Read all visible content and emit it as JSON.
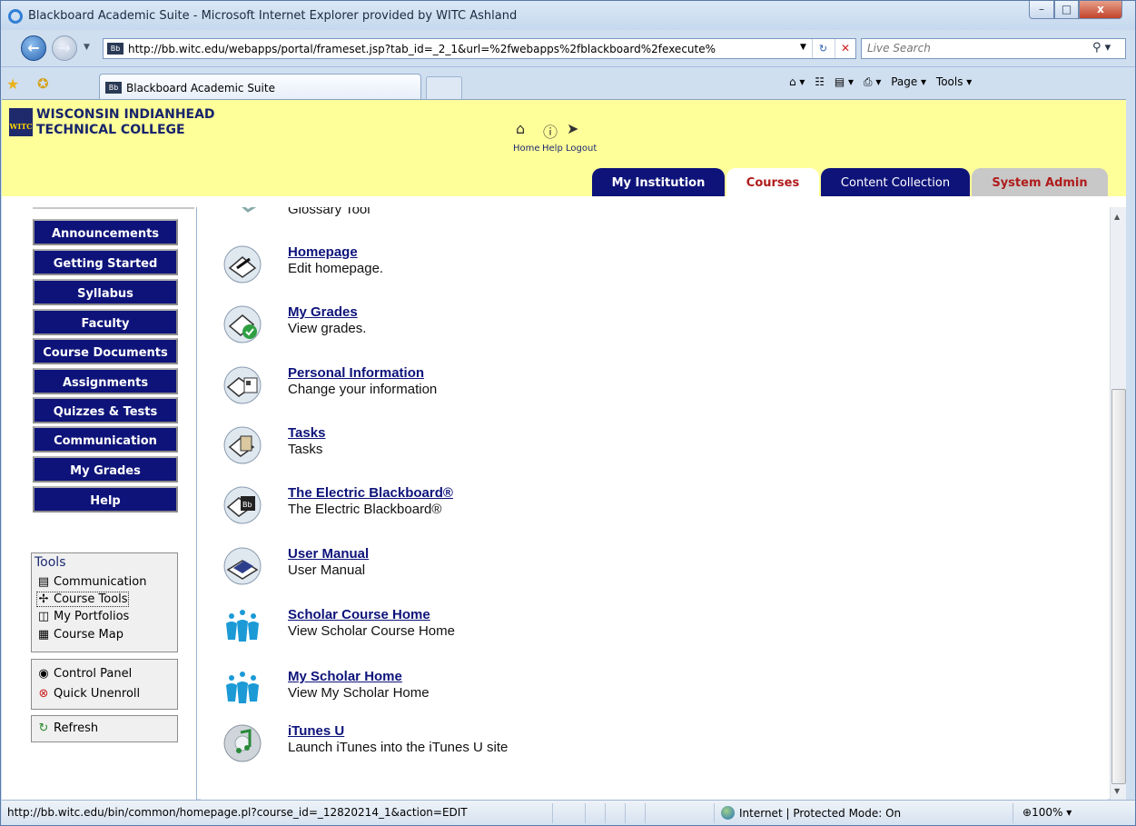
{
  "window": {
    "title": "Blackboard Academic Suite - Microsoft Internet Explorer provided by WITC Ashland",
    "minimize": "–",
    "maximize": "□",
    "close": "x"
  },
  "browser": {
    "address": "http://bb.witc.edu/webapps/portal/frameset.jsp?tab_id=_2_1&url=%2fwebapps%2fblackboard%2fexecute%",
    "search_placeholder": "Live Search",
    "tab_label": "Blackboard Academic Suite",
    "command_bar": [
      "Page ▾",
      "Tools ▾"
    ]
  },
  "bb": {
    "school_line1": "WISCONSIN INDIANHEAD",
    "school_line2": "TECHNICAL COLLEGE",
    "logo_text": "WITC",
    "top_links": [
      "Home",
      "Help",
      "Logout"
    ],
    "tabs": [
      "My Institution",
      "Courses",
      "Content Collection",
      "System Admin"
    ],
    "active_tab": "Courses"
  },
  "leftnav": {
    "buttons": [
      "Announcements",
      "Getting Started",
      "Syllabus",
      "Faculty",
      "Course Documents",
      "Assignments",
      "Quizzes & Tests",
      "Communication",
      "My Grades",
      "Help"
    ],
    "tools_heading": "Tools",
    "tools": [
      "Communication",
      "Course Tools",
      "My Portfolios",
      "Course Map"
    ],
    "control": [
      "Control Panel",
      "Quick Unenroll"
    ],
    "refresh": "Refresh"
  },
  "content": {
    "cut_off_item": "Glossary Tool",
    "items": [
      {
        "title": "Homepage",
        "desc": "Edit homepage.",
        "icon": "homepage-icon"
      },
      {
        "title": "My Grades",
        "desc": "View grades.",
        "icon": "grades-icon"
      },
      {
        "title": "Personal Information",
        "desc": "Change your information",
        "icon": "personal-info-icon"
      },
      {
        "title": "Tasks",
        "desc": "Tasks",
        "icon": "tasks-icon"
      },
      {
        "title": "The Electric Blackboard®",
        "desc": "The Electric Blackboard®",
        "icon": "blackboard-icon"
      },
      {
        "title": "User Manual",
        "desc": "User Manual",
        "icon": "manual-icon"
      },
      {
        "title": "Scholar Course Home",
        "desc": "View Scholar Course Home",
        "icon": "scholar-icon"
      },
      {
        "title": "My Scholar Home",
        "desc": "View My Scholar Home",
        "icon": "scholar-icon"
      },
      {
        "title": "iTunes U",
        "desc": "Launch iTunes into the iTunes U site",
        "icon": "itunes-icon"
      }
    ]
  },
  "statusbar": {
    "url": "http://bb.witc.edu/bin/common/homepage.pl?course_id=_12820214_1&action=EDIT",
    "zone": "Internet | Protected Mode: On",
    "zoom": "100%"
  }
}
